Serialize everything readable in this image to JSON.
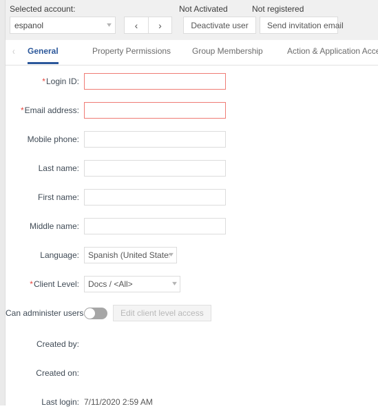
{
  "header": {
    "selected_account_label": "Selected account:",
    "account_value": "espanol",
    "prev_label": "‹",
    "next_label": "›",
    "not_activated_label": "Not Activated",
    "not_registered_label": "Not registered",
    "deactivate_button": "Deactivate user",
    "invite_button": "Send invitation email"
  },
  "tabs": {
    "scroll_left_icon": "‹",
    "items": [
      {
        "label": "General",
        "active": true
      },
      {
        "label": "Property Permissions",
        "active": false
      },
      {
        "label": "Group Membership",
        "active": false
      },
      {
        "label": "Action & Application Access",
        "active": false
      }
    ]
  },
  "form": {
    "required_marker": "*",
    "login_id": {
      "label": "Login ID:",
      "value": "",
      "placeholder": ""
    },
    "email_address": {
      "label": "Email address:",
      "value": "",
      "placeholder": ""
    },
    "mobile_phone": {
      "label": "Mobile phone:",
      "value": "",
      "placeholder": ""
    },
    "last_name": {
      "label": "Last name:",
      "value": "",
      "placeholder": ""
    },
    "first_name": {
      "label": "First name:",
      "value": "",
      "placeholder": ""
    },
    "middle_name": {
      "label": "Middle name:",
      "value": "",
      "placeholder": ""
    },
    "language": {
      "label": "Language:",
      "value": "Spanish (United States)"
    },
    "client_level": {
      "label": "Client Level:",
      "value": "Docs / <All>"
    },
    "can_administer_users": {
      "label": "Can administer users:",
      "enabled": false
    },
    "edit_client_level_access_button": "Edit client level access",
    "created_by": {
      "label": "Created by:",
      "value": ""
    },
    "created_on": {
      "label": "Created on:",
      "value": ""
    },
    "last_login": {
      "label": "Last login:",
      "value": "7/11/2020 2:59 AM"
    }
  },
  "colors": {
    "accent": "#2b579a",
    "error": "#ef7b74",
    "required": "#e8443c",
    "header_bg": "#f0f0f0"
  }
}
